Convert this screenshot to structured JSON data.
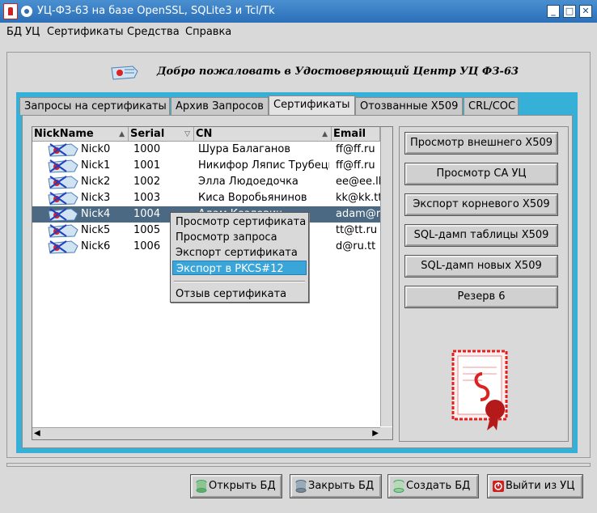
{
  "window": {
    "title": "УЦ-ФЗ-63 на базе OpenSSL, SQLite3 и Tcl/Tk",
    "buttons": {
      "minimize": "_",
      "maximize": "□",
      "close": "✕"
    }
  },
  "menubar": [
    "БД УЦ",
    "Сертификаты",
    "Средства",
    "Справка"
  ],
  "welcome": "Добро пожаловать в Удостоверяющий Центр УЦ ФЗ-63",
  "tabs": [
    "Запросы на сертификаты",
    "Архив Запросов",
    "Сертификаты",
    "Отозванные X509",
    "CRL/COC"
  ],
  "active_tab": "Сертификаты",
  "table": {
    "columns": [
      "NickName",
      "Serial",
      "CN",
      "Email"
    ],
    "rows": [
      {
        "nick": "Nick0",
        "serial": "1000",
        "cn": "Шура Балаганов",
        "email": "ff@ff.ru"
      },
      {
        "nick": "Nick1",
        "serial": "1001",
        "cn": "Никифор Ляпис Трубецкой",
        "email": "ff@ff.ru"
      },
      {
        "nick": "Nick2",
        "serial": "1002",
        "cn": "Элла Людоедочка",
        "email": "ee@ee.ll"
      },
      {
        "nick": "Nick3",
        "serial": "1003",
        "cn": "Киса Воробьянинов",
        "email": "kk@kk.tt"
      },
      {
        "nick": "Nick4",
        "serial": "1004",
        "cn": "Адам Козлевич",
        "email": "adam@ru"
      },
      {
        "nick": "Nick5",
        "serial": "1005",
        "cn": "",
        "email": "tt@tt.ru"
      },
      {
        "nick": "Nick6",
        "serial": "1006",
        "cn": "",
        "email": "d@ru.tt"
      }
    ],
    "selected_row": "Nick4"
  },
  "context_menu": {
    "items": [
      "Просмотр сертификата",
      "Просмотр запроса",
      "Экспорт сертификата",
      "Экспорт в PKCS#12",
      "Отзыв сертификата"
    ],
    "active": "Экспорт в PKCS#12"
  },
  "side_buttons": [
    "Просмотр внешнего X509",
    "Просмотр CA УЦ",
    "Экспорт корневого X509",
    "SQL-дамп таблицы X509",
    "SQL-дамп новых X509",
    "Резерв 6"
  ],
  "bottom_buttons": [
    "Открыть БД",
    "Закрыть БД",
    "Создать БД",
    "Выйти из УЦ"
  ],
  "colors": {
    "accent": "#36b0d6",
    "selection": "#4b6983",
    "title_bar": "#2b6fb8",
    "seal_red": "#d22222"
  },
  "icons": [
    "app-icon",
    "window-menu-icon",
    "certificate-icon",
    "database-icon",
    "exit-icon",
    "seal-icon"
  ]
}
